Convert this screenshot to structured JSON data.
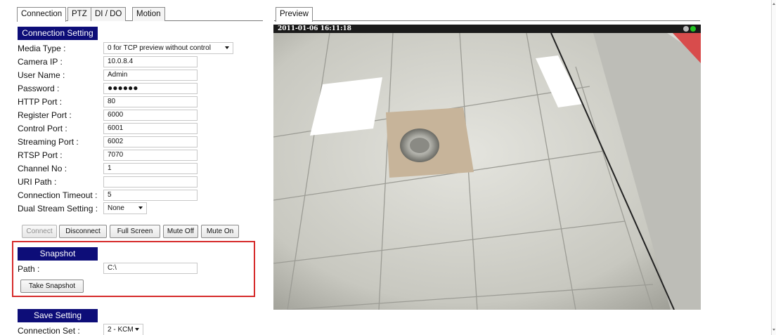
{
  "tabs": [
    "Connection",
    "PTZ",
    "DI / DO",
    "Motion"
  ],
  "connection_setting": {
    "header": "Connection Setting",
    "media_type": {
      "label": "Media Type :",
      "value": "0 for TCP preview without control"
    },
    "camera_ip": {
      "label": "Camera IP :",
      "value": "10.0.8.4"
    },
    "user_name": {
      "label": "User Name :",
      "value": "Admin"
    },
    "password": {
      "label": "Password :",
      "value": "●●●●●●"
    },
    "http_port": {
      "label": "HTTP Port :",
      "value": "80"
    },
    "register_port": {
      "label": "Register Port :",
      "value": "6000"
    },
    "control_port": {
      "label": "Control Port :",
      "value": "6001"
    },
    "streaming_port": {
      "label": "Streaming Port :",
      "value": "6002"
    },
    "rtsp_port": {
      "label": "RTSP Port :",
      "value": "7070"
    },
    "channel_no": {
      "label": "Channel No :",
      "value": "1"
    },
    "uri_path": {
      "label": "URI Path :",
      "value": ""
    },
    "connection_timeout": {
      "label": "Connection Timeout :",
      "value": "5"
    },
    "dual_stream": {
      "label": "Dual Stream Setting :",
      "value": "None"
    }
  },
  "buttons": {
    "connect": "Connect",
    "disconnect": "Disconnect",
    "full_screen": "Full Screen",
    "mute_off": "Mute Off",
    "mute_on": "Mute On"
  },
  "snapshot": {
    "header": "Snapshot",
    "path_label": "Path :",
    "path_value": "C:\\",
    "button": "Take Snapshot"
  },
  "save_setting": {
    "header": "Save Setting",
    "connection_set_label": "Connection Set :",
    "connection_set_value": "2 - KCM"
  },
  "preview": {
    "tab": "Preview",
    "timestamp": "2011-01-06 16:11:18"
  },
  "colors": {
    "header_bg": "#0d0d78",
    "highlight_border": "#d62b2b",
    "status_gray": "#bbbbbb",
    "status_green": "#22c422"
  }
}
